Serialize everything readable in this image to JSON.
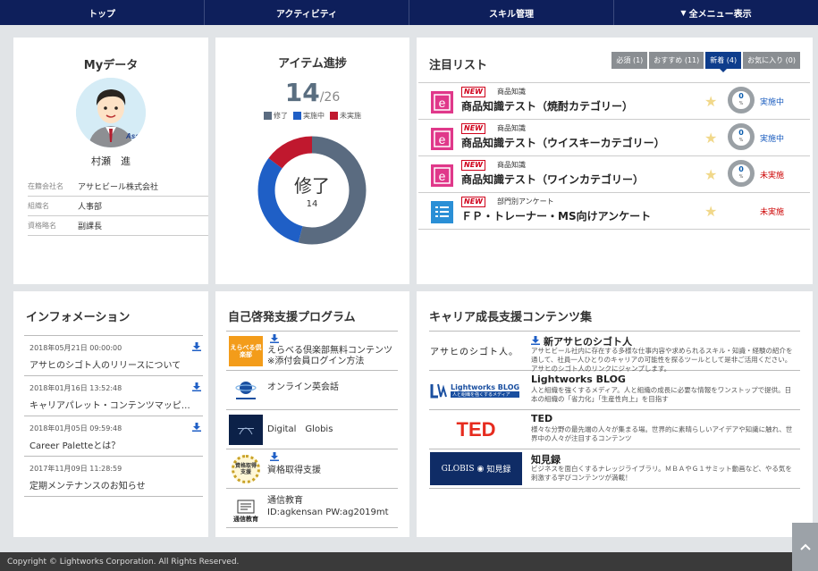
{
  "nav": [
    "トップ",
    "アクティビティ",
    "スキル管理",
    "全メニュー表示"
  ],
  "mydata": {
    "title": "Myデータ",
    "avatar_text": "Asahi",
    "name": "村瀬　進",
    "rows": [
      {
        "k": "在籍会社名",
        "v": "アサヒビール株式会社"
      },
      {
        "k": "組織名",
        "v": "人事部"
      },
      {
        "k": "資格略名",
        "v": "副課長"
      }
    ]
  },
  "progress": {
    "title": "アイテム進捗",
    "done": "14",
    "total": "/26",
    "legend": [
      {
        "label": "修了",
        "color": "#5a6b80"
      },
      {
        "label": "実施中",
        "color": "#1f5fc6"
      },
      {
        "label": "未実施",
        "color": "#c0182e"
      }
    ],
    "center_label": "修了",
    "center_count": "14",
    "fractions": {
      "done": 0.54,
      "in_progress": 0.31,
      "not_started": 0.15
    }
  },
  "featured": {
    "title": "注目リスト",
    "tabs": [
      {
        "label": "必須 (1)",
        "active": false
      },
      {
        "label": "おすすめ (11)",
        "active": false
      },
      {
        "label": "新着 (4)",
        "active": true
      },
      {
        "label": "お気に入り (0)",
        "active": false
      }
    ],
    "new_label": "NEW",
    "items": [
      {
        "cat": "商品知識",
        "title": "商品知識テスト（焼酎カテゴリー）",
        "pct": "0",
        "pct_unit": "%",
        "status": "実施中",
        "status_color": "blue",
        "icon": "e-learning-icon"
      },
      {
        "cat": "商品知識",
        "title": "商品知識テスト（ウイスキーカテゴリー）",
        "pct": "0",
        "pct_unit": "%",
        "status": "実施中",
        "status_color": "blue",
        "icon": "e-learning-icon"
      },
      {
        "cat": "商品知識",
        "title": "商品知識テスト（ワインカテゴリー）",
        "pct": "0",
        "pct_unit": "%",
        "status": "未実施",
        "status_color": "red",
        "icon": "e-learning-icon"
      },
      {
        "cat": "部門別アンケート",
        "title": "ＦＰ・トレーナー・MS向けアンケート",
        "pct": "",
        "pct_unit": "",
        "status": "未実施",
        "status_color": "red",
        "icon": "survey-icon"
      }
    ]
  },
  "info": {
    "title": "インフォメーション",
    "items": [
      {
        "date": "2018年05月21日 00:00:00",
        "text": "アサヒのシゴト人のリリースについて",
        "dl": true
      },
      {
        "date": "2018年01月16日 13:52:48",
        "text": "キャリアパレット・コンテンツマッピ…",
        "dl": true
      },
      {
        "date": "2018年01月05日 09:59:48",
        "text": "Career Paletteとは？",
        "dl": true
      },
      {
        "date": "2017年11月09日 11:28:59",
        "text": "定期メンテナンスのお知らせ",
        "dl": false
      }
    ]
  },
  "selfdev": {
    "title": "自己啓発支援プログラム",
    "items": [
      {
        "line1": "えらべる倶楽部無料コンテンツ",
        "line2": "※添付会員ログイン方法",
        "dl": true,
        "logo": "erabel-logo",
        "logo_text": "えらべる倶楽部"
      },
      {
        "line1": "オンライン英会話",
        "line2": "",
        "dl": false,
        "logo": "online-english-logo",
        "logo_text": ""
      },
      {
        "line1": "Digital　Globis",
        "line2": "",
        "dl": false,
        "logo": "digital-globis-logo",
        "logo_text": ""
      },
      {
        "line1": "資格取得支援",
        "line2": "",
        "dl": true,
        "logo": "qualification-logo",
        "logo_text": "資格取得支援"
      },
      {
        "line1": "通信教育",
        "line2": "ID:agkensan PW:ag2019mt",
        "dl": false,
        "logo": "correspondence-logo",
        "logo_text": "通信教育"
      }
    ]
  },
  "career": {
    "title": "キャリア成長支援コンテンツ集",
    "items": [
      {
        "head": "新アサヒのシゴト人",
        "desc": "アサヒビール社内に存在する多様な仕事内容や求められるスキル・知識・経験の紹介を通して、社員一人ひとりのキャリアの可能性を探るツールとして是非ご活用ください。アサヒのシゴト人のリンクにジャンプします。",
        "dl": true,
        "logo": "shigotojin-logo",
        "logo_text": "アサヒのシゴト人。"
      },
      {
        "head": "Lightworks BLOG",
        "desc": "人と組織を強くするメディア。人と組織の成長に必要な情報をワンストップで提供。日本の組織の「省力化」「生産性向上」を目指す",
        "dl": false,
        "logo": "lightworks-blog-logo",
        "logo_text": "Lightworks BLOG",
        "logo_sub": "人と組織を強くするメディア"
      },
      {
        "head": "TED",
        "desc": "様々な分野の最先端の人々が集まる場。世界的に素晴らしいアイデアや知識に触れ、世界中の人々が注目するコンテンツ",
        "dl": false,
        "logo": "ted-logo",
        "logo_text": "TED"
      },
      {
        "head": "知見録",
        "desc": "ビジネスを面白くするナレッジライブラリ。ＭＢＡやＧ１サミット動画など、やる気を刺激する学びコンテンツが満載！",
        "dl": false,
        "logo": "globis-chikenroku-logo",
        "logo_text": "GLOBIS",
        "logo_sub": "知見録"
      }
    ]
  },
  "footer": "Copyright © Lightworks Corporation. All Rights Reserved.",
  "colors": {
    "nav": "#0e1f5b",
    "accent": "#0e3d8c",
    "new": "#d0021b"
  }
}
